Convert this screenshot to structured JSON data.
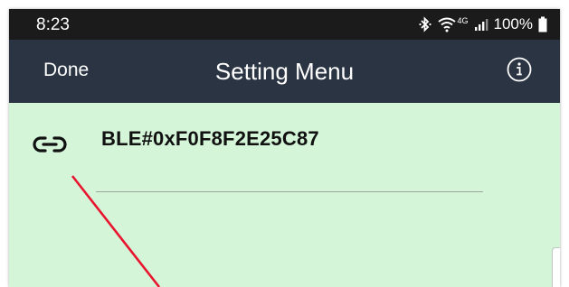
{
  "status_bar": {
    "time": "8:23",
    "network": "4G",
    "battery": "100%",
    "icons": [
      "bluetooth-icon",
      "wifi-icon",
      "signal-icon",
      "battery-icon"
    ]
  },
  "nav": {
    "done_label": "Done",
    "title": "Setting Menu",
    "info_icon": "info-icon"
  },
  "device": {
    "name": "BLE#0xF0F8F2E25C87",
    "icon": "link-icon"
  },
  "colors": {
    "status_bar_bg": "#1b1b1b",
    "nav_bg": "#2a3442",
    "content_bg": "#d4f5d8",
    "annotation": "#e8152f"
  }
}
